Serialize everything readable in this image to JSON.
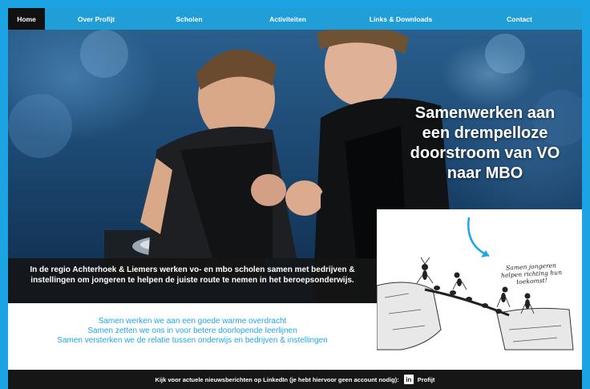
{
  "nav": {
    "items": [
      {
        "label": "Home"
      },
      {
        "label": "Over Profijt"
      },
      {
        "label": "Scholen"
      },
      {
        "label": "Activiteiten"
      },
      {
        "label": "Links & Downloads"
      },
      {
        "label": "Contact"
      }
    ]
  },
  "hero": {
    "headline": "Samenwerken aan een drempelloze doorstroom van VO naar MBO",
    "caption": "In de regio Achterhoek & Liemers werken vo- en mbo scholen samen met bedrijven & instellingen om jongeren te helpen de juiste route te nemen in het beroepsonderwijs.",
    "illustration_note": "Samen jongeren helpen richting hun toekomst!"
  },
  "mission": {
    "lines": [
      "Samen werken we aan een goede warme overdracht",
      "Samen zetten we ons in voor betere doorlopende leerlijnen",
      "Samen versterken we de relatie tussen onderwijs en bedrijven & instellingen"
    ]
  },
  "footer": {
    "text": "Kijk voor actuele nieuwsberichten op LinkedIn (je hebt hiervoor geen account nodig):",
    "linkedin_icon": "in",
    "link_label": "Profijt"
  },
  "colors": {
    "brand_blue": "#1ba3e3",
    "nav_blue": "#1f9ed8",
    "dark": "#161616",
    "mission_text": "#1ea7e5"
  }
}
